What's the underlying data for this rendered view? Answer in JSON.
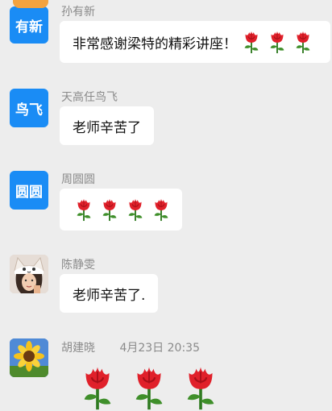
{
  "messages": [
    {
      "avatar_text": "有新",
      "sender": "孙有新",
      "text": "非常感谢梁特的精彩讲座！",
      "roses": 3
    },
    {
      "avatar_text": "鸟飞",
      "sender": "天高任鸟飞",
      "text": "老师辛苦了"
    },
    {
      "avatar_text": "圆圆",
      "sender": "周圆圆",
      "roses": 4
    },
    {
      "sender": "陈静雯",
      "text": "老师辛苦了."
    },
    {
      "sender": "胡建晓",
      "time": "4月23日 20:35",
      "roses": 3
    }
  ],
  "icons": {
    "avatar_1_badge": "decorative-badge-icon",
    "avatar_4": "cat-hat-portrait",
    "avatar_5": "sunflower",
    "sticker": "rose-icon"
  },
  "colors": {
    "background": "#ededed",
    "bubble": "#ffffff",
    "avatar_blue": "#1a8cf5",
    "rose": "#e0202a",
    "leaf": "#3f8f2a"
  }
}
